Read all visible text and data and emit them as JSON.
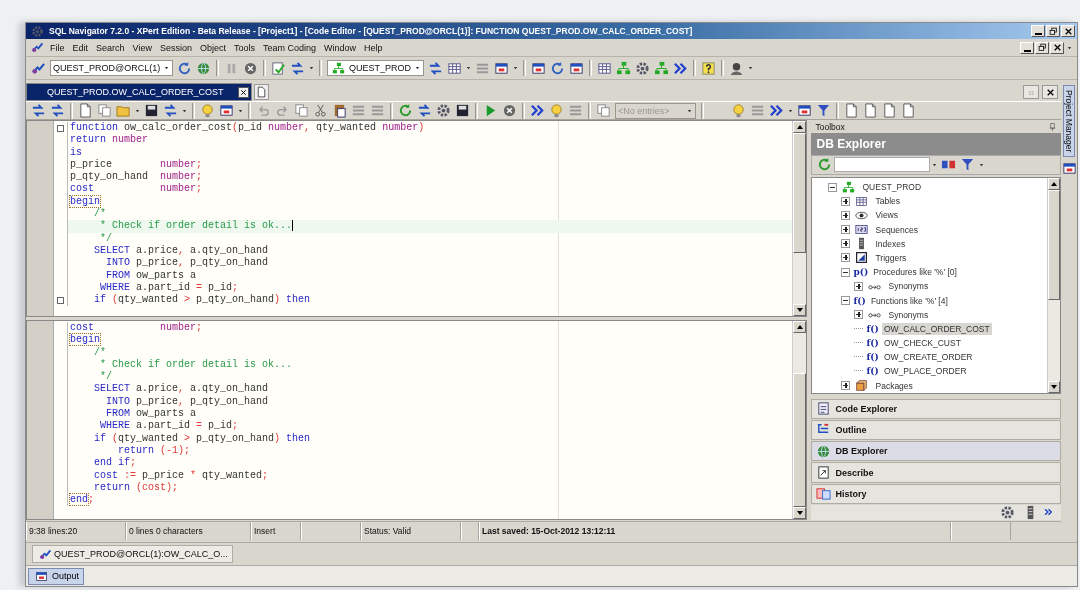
{
  "window": {
    "title": "SQL Navigator 7.2.0 - XPert Edition - Beta Release - [Project1] - [Code Editor - [QUEST_PROD@ORCL(1)]: FUNCTION QUEST_PROD.OW_CALC_ORDER_COST]"
  },
  "menu": [
    "File",
    "Edit",
    "Search",
    "View",
    "Session",
    "Object",
    "Tools",
    "Team Coding",
    "Window",
    "Help"
  ],
  "toolbar": {
    "connection": "QUEST_PROD@ORCL(1)",
    "schema": "QUEST_PROD"
  },
  "editor_tabs": [
    {
      "label": "QUEST_PROD.OW_CALC_ORDER_COST",
      "selected": true
    }
  ],
  "editor_toolbar": {
    "history_dropdown": {
      "text": "<No entries>",
      "disabled": true
    }
  },
  "editor_panes": [
    {
      "lines": [
        {
          "fold": true,
          "current": false,
          "tokens": [
            {
              "kind": "keyword",
              "text": "function"
            },
            {
              "kind": "plain",
              "text": " ow_calc_order_cost"
            },
            {
              "kind": "operator",
              "text": "("
            },
            {
              "kind": "plain",
              "text": "p_id "
            },
            {
              "kind": "type",
              "text": "number"
            },
            {
              "kind": "operator",
              "text": ", "
            },
            {
              "kind": "plain",
              "text": "qty_wanted "
            },
            {
              "kind": "type",
              "text": "number"
            },
            {
              "kind": "operator",
              "text": ")"
            }
          ]
        },
        {
          "fold": false,
          "current": false,
          "tokens": [
            {
              "kind": "keyword",
              "text": "return "
            },
            {
              "kind": "type",
              "text": "number"
            }
          ]
        },
        {
          "fold": false,
          "current": false,
          "tokens": [
            {
              "kind": "keyword",
              "text": "is"
            }
          ]
        },
        {
          "fold": false,
          "current": false,
          "tokens": [
            {
              "kind": "plain",
              "text": "p_price        "
            },
            {
              "kind": "type",
              "text": "number"
            },
            {
              "kind": "operator",
              "text": ";"
            }
          ]
        },
        {
          "fold": false,
          "current": false,
          "tokens": [
            {
              "kind": "plain",
              "text": "p_qty_on_hand  "
            },
            {
              "kind": "type",
              "text": "number"
            },
            {
              "kind": "operator",
              "text": ";"
            }
          ]
        },
        {
          "fold": false,
          "current": false,
          "tokens": [
            {
              "kind": "keyword",
              "text": "cost           "
            },
            {
              "kind": "type",
              "text": "number"
            },
            {
              "kind": "operator",
              "text": ";"
            }
          ]
        },
        {
          "fold": false,
          "current": false,
          "tokens": [
            {
              "kind": "matched",
              "text": "begin"
            }
          ]
        },
        {
          "fold": false,
          "current": false,
          "tokens": [
            {
              "kind": "comment",
              "text": "    /*"
            }
          ]
        },
        {
          "fold": false,
          "current": true,
          "tokens": [
            {
              "kind": "comment",
              "text": "     * Check if order detail is ok..."
            }
          ]
        },
        {
          "fold": false,
          "current": false,
          "tokens": [
            {
              "kind": "comment",
              "text": "     */"
            }
          ]
        },
        {
          "fold": false,
          "current": false,
          "tokens": [
            {
              "kind": "keyword",
              "text": "    SELECT"
            },
            {
              "kind": "plain",
              "text": " a.price"
            },
            {
              "kind": "operator",
              "text": ", "
            },
            {
              "kind": "plain",
              "text": "a.qty_on_hand"
            }
          ]
        },
        {
          "fold": false,
          "current": false,
          "tokens": [
            {
              "kind": "keyword",
              "text": "      INTO"
            },
            {
              "kind": "plain",
              "text": " p_price"
            },
            {
              "kind": "operator",
              "text": ", "
            },
            {
              "kind": "plain",
              "text": "p_qty_on_hand"
            }
          ]
        },
        {
          "fold": false,
          "current": false,
          "tokens": [
            {
              "kind": "keyword",
              "text": "      FROM"
            },
            {
              "kind": "plain",
              "text": " ow_parts a"
            }
          ]
        },
        {
          "fold": false,
          "current": false,
          "tokens": [
            {
              "kind": "keyword",
              "text": "     WHERE"
            },
            {
              "kind": "plain",
              "text": " a.part_id "
            },
            {
              "kind": "operator",
              "text": "="
            },
            {
              "kind": "plain",
              "text": " p_id"
            },
            {
              "kind": "operator",
              "text": ";"
            }
          ]
        },
        {
          "fold": true,
          "current": false,
          "tokens": [
            {
              "kind": "keyword",
              "text": "    if"
            },
            {
              "kind": "operator",
              "text": " ("
            },
            {
              "kind": "plain",
              "text": "qty_wanted "
            },
            {
              "kind": "operator",
              "text": ">"
            },
            {
              "kind": "plain",
              "text": " p_qty_on_hand"
            },
            {
              "kind": "operator",
              "text": ")"
            },
            {
              "kind": "keyword",
              "text": " then"
            }
          ]
        }
      ]
    },
    {
      "lines": [
        {
          "fold": false,
          "current": false,
          "tokens": [
            {
              "kind": "keyword",
              "text": "cost           "
            },
            {
              "kind": "type",
              "text": "number"
            },
            {
              "kind": "operator",
              "text": ";"
            }
          ]
        },
        {
          "fold": false,
          "current": false,
          "tokens": [
            {
              "kind": "matched",
              "text": "begin"
            }
          ]
        },
        {
          "fold": false,
          "current": false,
          "tokens": [
            {
              "kind": "comment",
              "text": "    /*"
            }
          ]
        },
        {
          "fold": false,
          "current": false,
          "tokens": [
            {
              "kind": "comment",
              "text": "     * Check if order detail is ok..."
            }
          ]
        },
        {
          "fold": false,
          "current": false,
          "tokens": [
            {
              "kind": "comment",
              "text": "     */"
            }
          ]
        },
        {
          "fold": false,
          "current": false,
          "tokens": [
            {
              "kind": "keyword",
              "text": "    SELECT"
            },
            {
              "kind": "plain",
              "text": " a.price"
            },
            {
              "kind": "operator",
              "text": ", "
            },
            {
              "kind": "plain",
              "text": "a.qty_on_hand"
            }
          ]
        },
        {
          "fold": false,
          "current": false,
          "tokens": [
            {
              "kind": "keyword",
              "text": "      INTO"
            },
            {
              "kind": "plain",
              "text": " p_price"
            },
            {
              "kind": "operator",
              "text": ", "
            },
            {
              "kind": "plain",
              "text": "p_qty_on_hand"
            }
          ]
        },
        {
          "fold": false,
          "current": false,
          "tokens": [
            {
              "kind": "keyword",
              "text": "      FROM"
            },
            {
              "kind": "plain",
              "text": " ow_parts a"
            }
          ]
        },
        {
          "fold": false,
          "current": false,
          "tokens": [
            {
              "kind": "keyword",
              "text": "     WHERE"
            },
            {
              "kind": "plain",
              "text": " a.part_id "
            },
            {
              "kind": "operator",
              "text": "="
            },
            {
              "kind": "plain",
              "text": " p_id"
            },
            {
              "kind": "operator",
              "text": ";"
            }
          ]
        },
        {
          "fold": false,
          "current": false,
          "tokens": [
            {
              "kind": "keyword",
              "text": "    if"
            },
            {
              "kind": "operator",
              "text": " ("
            },
            {
              "kind": "plain",
              "text": "qty_wanted "
            },
            {
              "kind": "operator",
              "text": ">"
            },
            {
              "kind": "plain",
              "text": " p_qty_on_hand"
            },
            {
              "kind": "operator",
              "text": ")"
            },
            {
              "kind": "keyword",
              "text": " then"
            }
          ]
        },
        {
          "fold": false,
          "current": false,
          "tokens": [
            {
              "kind": "keyword",
              "text": "        return"
            },
            {
              "kind": "operator",
              "text": " (-1);"
            }
          ]
        },
        {
          "fold": false,
          "current": false,
          "tokens": [
            {
              "kind": "keyword",
              "text": "    end if"
            },
            {
              "kind": "operator",
              "text": ";"
            }
          ]
        },
        {
          "fold": false,
          "current": false,
          "tokens": [
            {
              "kind": "keyword",
              "text": "    cost"
            },
            {
              "kind": "operator",
              "text": " := "
            },
            {
              "kind": "plain",
              "text": "p_price "
            },
            {
              "kind": "operator",
              "text": "*"
            },
            {
              "kind": "plain",
              "text": " qty_wanted"
            },
            {
              "kind": "operator",
              "text": ";"
            }
          ]
        },
        {
          "fold": false,
          "current": false,
          "tokens": [
            {
              "kind": "keyword",
              "text": "    return"
            },
            {
              "kind": "operator",
              "text": " (cost);"
            }
          ]
        },
        {
          "fold": false,
          "current": false,
          "tokens": [
            {
              "kind": "matched",
              "text": "end"
            },
            {
              "kind": "operator",
              "text": ";"
            }
          ]
        }
      ]
    }
  ],
  "toolbox": {
    "header": "Toolbox",
    "title": "DB Explorer",
    "tree": [
      {
        "label": "QUEST_PROD",
        "kind": "schema",
        "expanded": true,
        "selected": false,
        "children": [
          {
            "label": "Tables",
            "kind": "tables",
            "expanded": false,
            "selected": false
          },
          {
            "label": "Views",
            "kind": "views",
            "expanded": false,
            "selected": false
          },
          {
            "label": "Sequences",
            "kind": "sequences",
            "expanded": false,
            "selected": false
          },
          {
            "label": "Indexes",
            "kind": "indexes",
            "expanded": false,
            "selected": false
          },
          {
            "label": "Triggers",
            "kind": "triggers",
            "expanded": false,
            "selected": false
          },
          {
            "label": "Procedures like '%' [0]",
            "kind": "procedures",
            "glyph": "p()",
            "expanded": true,
            "selected": false,
            "children": [
              {
                "label": "Synonyms",
                "kind": "synonyms",
                "expanded": false,
                "selected": false
              }
            ]
          },
          {
            "label": "Functions like '%' [4]",
            "kind": "functions",
            "glyph": "f()",
            "expanded": true,
            "selected": false,
            "children": [
              {
                "label": "Synonyms",
                "kind": "synonyms",
                "expanded": false,
                "selected": false
              },
              {
                "label": "OW_CALC_ORDER_COST",
                "kind": "function",
                "glyph": "f()",
                "selected": true
              },
              {
                "label": "OW_CHECK_CUST",
                "kind": "function",
                "glyph": "f()",
                "selected": false
              },
              {
                "label": "OW_CREATE_ORDER",
                "kind": "function",
                "glyph": "f()",
                "selected": false
              },
              {
                "label": "OW_PLACE_ORDER",
                "kind": "function",
                "glyph": "f()",
                "selected": false
              }
            ]
          },
          {
            "label": "Packages",
            "kind": "packages",
            "expanded": false,
            "selected": false
          }
        ]
      }
    ],
    "sections": [
      {
        "label": "Code Explorer",
        "kind": "code",
        "selected": false
      },
      {
        "label": "Outline",
        "kind": "outline",
        "selected": false
      },
      {
        "label": "DB Explorer",
        "kind": "db",
        "selected": true
      },
      {
        "label": "Describe",
        "kind": "describe",
        "selected": false
      },
      {
        "label": "History",
        "kind": "history",
        "selected": false
      }
    ]
  },
  "side_tab": "Project Manager",
  "status_bar": [
    "9:38 lines:20",
    "0 lines 0 characters",
    "Insert",
    "Status: Valid",
    "Last saved: 15-Oct-2012 13:12:11"
  ],
  "task_tabs": [
    "QUEST_PROD@ORCL(1):OW_CALC_O..."
  ],
  "output_button": "Output"
}
